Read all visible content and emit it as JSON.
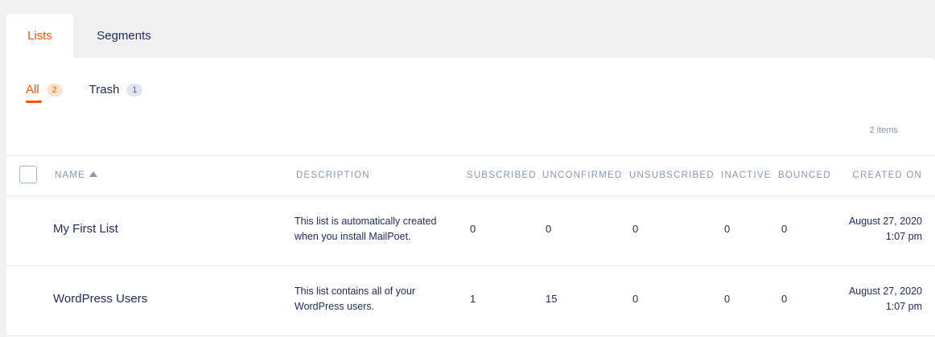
{
  "top_tabs": [
    {
      "label": "Lists",
      "active": true
    },
    {
      "label": "Segments",
      "active": false
    }
  ],
  "filters": [
    {
      "label": "All",
      "count": "2",
      "active": true
    },
    {
      "label": "Trash",
      "count": "1",
      "active": false
    }
  ],
  "items_count": "2 items",
  "columns": {
    "name": "NAME",
    "description": "DESCRIPTION",
    "subscribed": "SUBSCRIBED",
    "unconfirmed": "UNCONFIRMED",
    "unsubscribed": "UNSUBSCRIBED",
    "inactive": "INACTIVE",
    "bounced": "BOUNCED",
    "created_on": "CREATED ON"
  },
  "rows": [
    {
      "name": "My First List",
      "description_line1": "This list is automatically created",
      "description_line2": "when you install MailPoet.",
      "subscribed": "0",
      "unconfirmed": "0",
      "unsubscribed": "0",
      "inactive": "0",
      "bounced": "0",
      "created_date": "August 27, 2020",
      "created_time": "1:07 pm"
    },
    {
      "name": "WordPress Users",
      "description_line1": "This list contains all of your",
      "description_line2": "WordPress users.",
      "subscribed": "1",
      "unconfirmed": "15",
      "unsubscribed": "0",
      "inactive": "0",
      "bounced": "0",
      "created_date": "August 27, 2020",
      "created_time": "1:07 pm"
    }
  ],
  "colors": {
    "accent": "#ff5301",
    "text": "#1e2a5a",
    "muted": "#8c94b8",
    "background": "#f0f0f1"
  },
  "sort": {
    "column": "name",
    "direction": "ascending",
    "icon": "sort-asc-icon"
  }
}
